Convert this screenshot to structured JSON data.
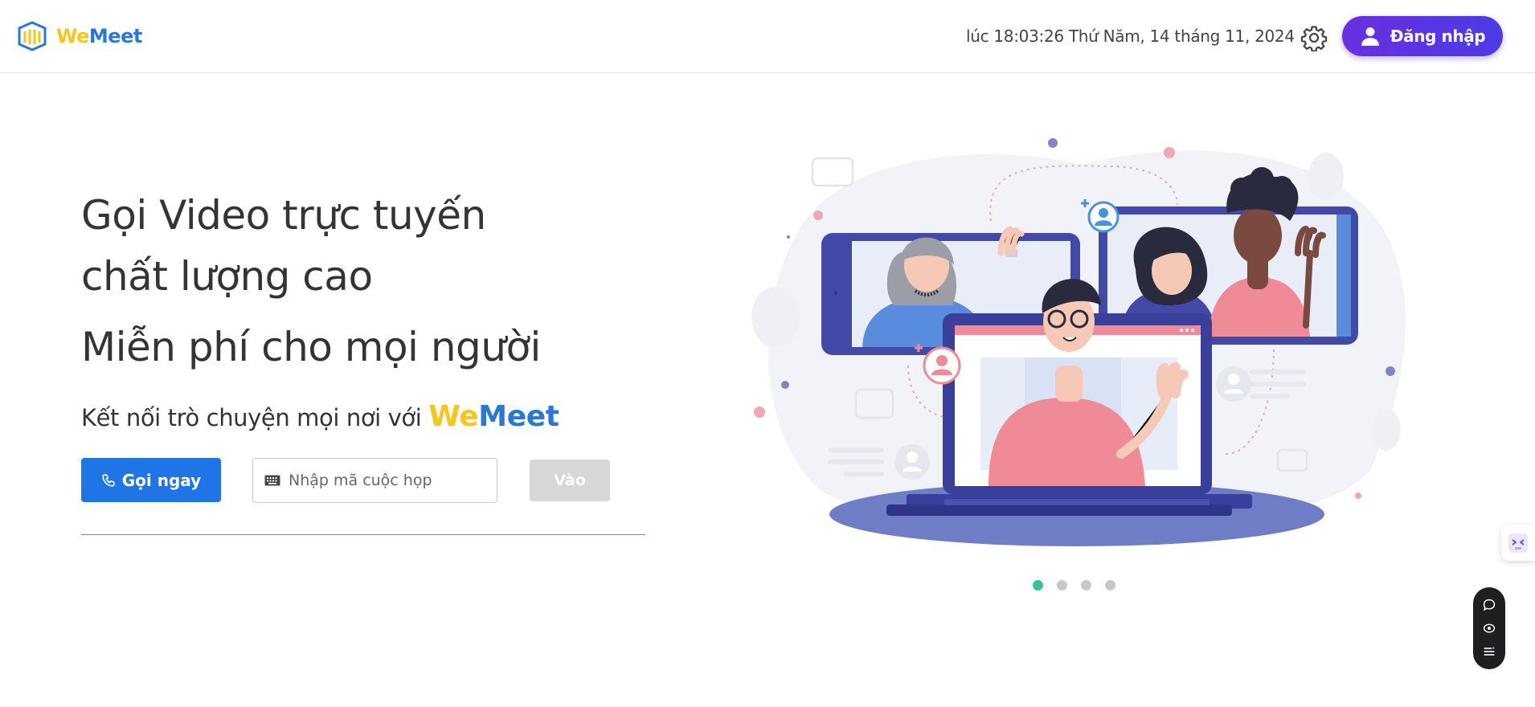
{
  "header": {
    "logo": {
      "we": "We",
      "meet": "Meet"
    },
    "datetime": "lúc 18:03:26 Thứ Năm, 14 tháng 11, 2024",
    "settings_icon": "gear-icon",
    "login_label": "Đăng nhập",
    "login_icon": "user-icon"
  },
  "hero": {
    "title_line1": "Gọi Video trực tuyến",
    "title_line2": "chất lượng cao",
    "title_line3": "Miễn phí cho mọi người",
    "subtitle": "Kết nối trò chuyện mọi nơi với",
    "brand_we": "We",
    "brand_meet": "Meet",
    "call_button": "Gọi ngay",
    "call_icon": "phone-icon",
    "code_input": {
      "placeholder": "Nhập mã cuộc họp",
      "value": "",
      "icon": "keyboard-icon"
    },
    "join_button": "Vào"
  },
  "carousel": {
    "active_index": 0,
    "count": 4
  },
  "floating_toolbar": {
    "icons": [
      "chat-icon",
      "eye-icon",
      "list-icon"
    ]
  },
  "side_tab": {
    "icon": "translate-icon"
  },
  "colors": {
    "brand_yellow": "#f6c61a",
    "brand_blue": "#2a77d6",
    "login_gradient_start": "#6a2fe0",
    "login_gradient_end": "#4c3be6",
    "call_button": "#1f74e6",
    "carousel_active": "#35c29a",
    "join_disabled": "#d7d7d7"
  }
}
